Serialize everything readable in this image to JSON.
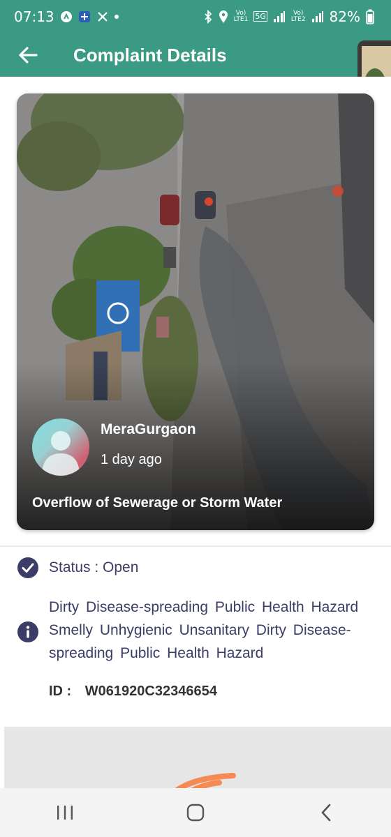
{
  "status_bar": {
    "time": "07:13",
    "network_1": [
      "Vo)",
      "LTE1"
    ],
    "network_5g": "5G",
    "network_2": [
      "Vo)",
      "LTE2"
    ],
    "battery": "82%"
  },
  "app_bar": {
    "title": "Complaint Details",
    "color": "#3a9a83",
    "back_icon": "arrow-left-icon",
    "menu_icon": "more-vert-icon"
  },
  "complaint": {
    "user": "MeraGurgaon",
    "time_ago": "1 day ago",
    "title": "Overflow of Sewerage or Storm Water",
    "status": "Status : Open",
    "tags": "Dirty  Disease-spreading  Public Health Hazard  Smelly  Unhygienic  Unsanitary  Dirty  Disease-spreading  Public Health Hazard",
    "id_label": "ID :",
    "id_value": "W061920C32346654"
  },
  "colors": {
    "accent": "#3a9a83",
    "status_icon": "#3c3d66",
    "logo": "#f58a55"
  },
  "nav": {
    "recents_icon": "recents-icon",
    "home_icon": "home-icon",
    "back_icon": "back-chevron-icon"
  }
}
